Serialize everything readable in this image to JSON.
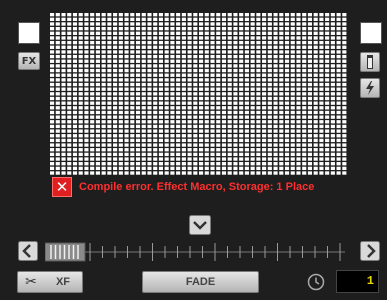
{
  "left_panel": {
    "fx_label": "FX"
  },
  "matrix": {
    "cols": 52,
    "rows": 35,
    "cell_color": "#ffffff",
    "bg_color": "#1e1e1e"
  },
  "error": {
    "icon": "close-icon",
    "text": "Compile error. Effect Macro, Storage: 1 Place",
    "color": "#ff2f2f"
  },
  "transport": {
    "prev_icon": "chevron-left-icon",
    "next_icon": "chevron-right-icon",
    "expand_icon": "chevron-down-icon",
    "slider_position": 0.1
  },
  "bottom": {
    "xf_label": "XF",
    "fade_label": "FADE",
    "counter_value": "1",
    "counter_color": "#e8d800"
  },
  "right_panel": {
    "level_icon": "level-meter-icon",
    "flash_icon": "lightning-icon"
  }
}
